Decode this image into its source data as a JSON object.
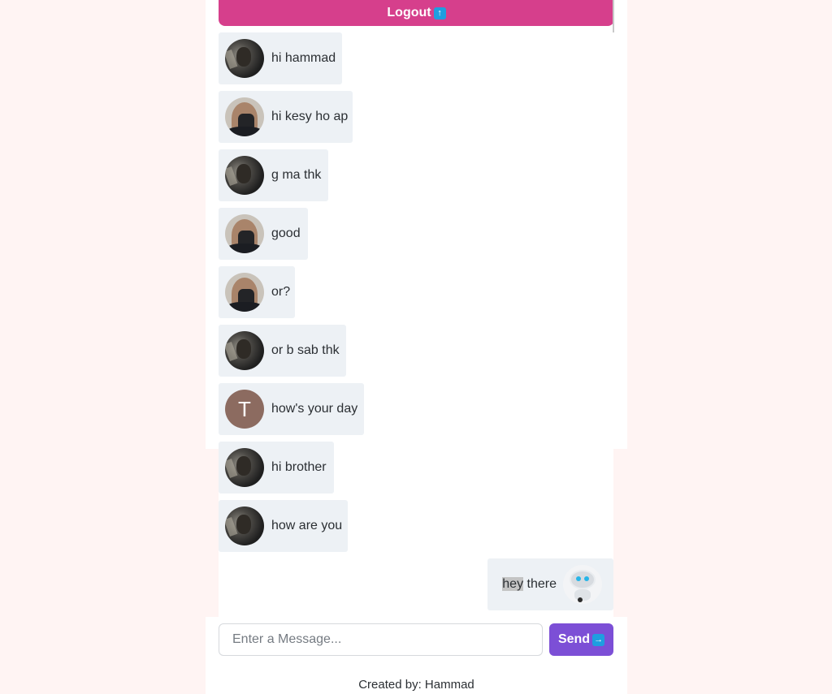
{
  "header": {
    "logout_label": "Logout",
    "logout_icon": "up-arrow-icon"
  },
  "messages": [
    {
      "text": "hi hammad",
      "avatar": "avatar-user-a"
    },
    {
      "text": "hi kesy ho ap",
      "avatar": "avatar-user-b"
    },
    {
      "text": "g ma thk",
      "avatar": "avatar-user-a"
    },
    {
      "text": "good",
      "avatar": "avatar-user-b"
    },
    {
      "text": "or?",
      "avatar": "avatar-user-b"
    },
    {
      "text": "or b sab thk",
      "avatar": "avatar-user-a"
    },
    {
      "text": "how's your day",
      "avatar": "avatar-letter",
      "avatar_letter": "T"
    },
    {
      "text": "hi brother",
      "avatar": "avatar-user-a"
    },
    {
      "text": "how are you",
      "avatar": "avatar-user-a"
    }
  ],
  "own_message": {
    "highlight": "hey",
    "rest": " there",
    "avatar": "robot-avatar"
  },
  "composer": {
    "placeholder": "Enter a Message...",
    "send_label": "Send",
    "send_icon": "right-arrow-icon"
  },
  "footer": {
    "text": "Created by: Hammad"
  },
  "colors": {
    "background": "#fff4f3",
    "logout": "#d63f8c",
    "send": "#7c4fd6",
    "bubble": "#edf1f5"
  }
}
